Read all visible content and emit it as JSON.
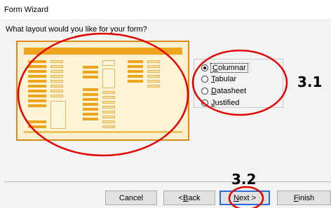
{
  "window": {
    "title": "Form Wizard",
    "question": "What layout would you like for your form?"
  },
  "layout_options": [
    {
      "prefix": "",
      "underline": "C",
      "rest": "olumnar",
      "selected": true
    },
    {
      "prefix": "",
      "underline": "T",
      "rest": "abular",
      "selected": false
    },
    {
      "prefix": "",
      "underline": "D",
      "rest": "atasheet",
      "selected": false
    },
    {
      "prefix": "",
      "underline": "J",
      "rest": "ustified",
      "selected": false
    }
  ],
  "buttons": {
    "cancel": "Cancel",
    "back": {
      "prefix": "< ",
      "underline": "B",
      "rest": "ack"
    },
    "next": {
      "prefix": "",
      "underline": "N",
      "rest": "ext >"
    },
    "finish": {
      "prefix": "",
      "underline": "F",
      "rest": "inish"
    }
  },
  "annotations": {
    "label_1": "3.1",
    "label_2": "3.2",
    "highlight_color": "#e00000"
  }
}
